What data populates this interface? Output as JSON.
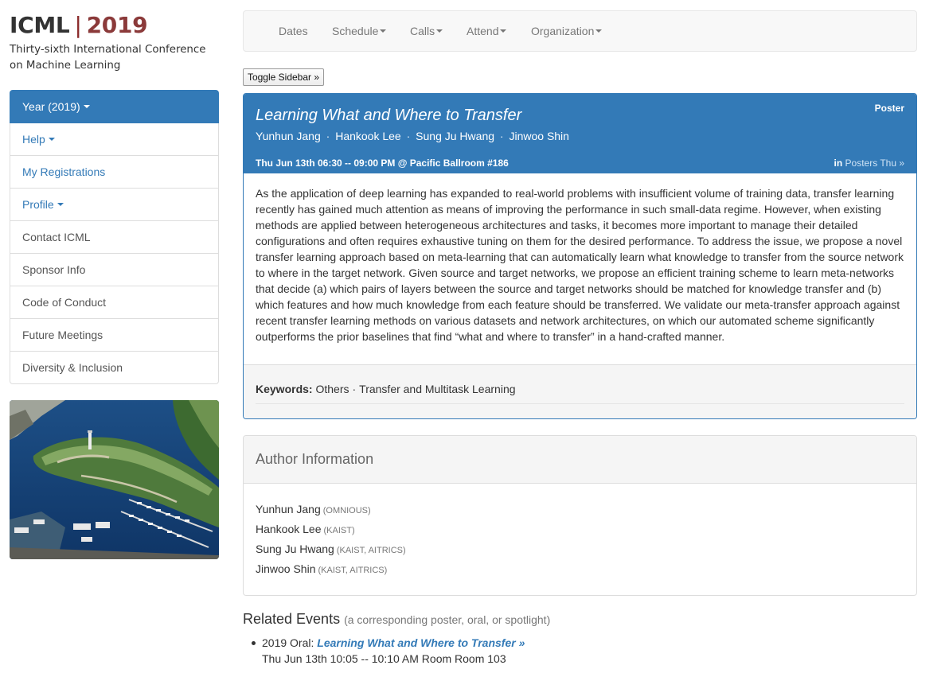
{
  "logo": {
    "name": "ICML",
    "separator": "|",
    "year": "2019",
    "subtitle": "Thirty-sixth International Conference on Machine Learning"
  },
  "sidebar": {
    "items": [
      {
        "label": "Year (2019)",
        "caret": true
      },
      {
        "label": "Help",
        "caret": true
      },
      {
        "label": "My Registrations",
        "caret": false
      },
      {
        "label": "Profile",
        "caret": true
      },
      {
        "label": "Contact ICML",
        "caret": false
      },
      {
        "label": "Sponsor Info",
        "caret": false
      },
      {
        "label": "Code of Conduct",
        "caret": false
      },
      {
        "label": "Future Meetings",
        "caret": false
      },
      {
        "label": "Diversity & Inclusion",
        "caret": false
      }
    ]
  },
  "navbar": {
    "items": [
      {
        "label": "Dates",
        "caret": false
      },
      {
        "label": "Schedule",
        "caret": true
      },
      {
        "label": "Calls",
        "caret": true
      },
      {
        "label": "Attend",
        "caret": true
      },
      {
        "label": "Organization",
        "caret": true
      }
    ]
  },
  "toggle_sidebar": {
    "label": "Toggle Sidebar »"
  },
  "event": {
    "type": "Poster",
    "title": "Learning What and Where to Transfer",
    "authors": [
      "Yunhun Jang",
      "Hankook Lee",
      "Sung Ju Hwang",
      "Jinwoo Shin"
    ],
    "author_separator": "·",
    "time_location": "Thu Jun 13th 06:30 -- 09:00 PM @ Pacific Ballroom #186",
    "in_label": "in",
    "in_link": "Posters Thu »",
    "abstract": "As the application of deep learning has expanded to real-world problems with insufficient volume of training data, transfer learning recently has gained much attention as means of improving the performance in such small-data regime. However, when existing methods are applied between heterogeneous architectures and tasks, it becomes more important to manage their detailed configurations and often requires exhaustive tuning on them for the desired performance. To address the issue, we propose a novel transfer learning approach based on meta-learning that can automatically learn what knowledge to transfer from the source network to where in the target network. Given source and target networks, we propose an efficient training scheme to learn meta-networks that decide (a) which pairs of layers between the source and target networks should be matched for knowledge transfer and (b) which features and how much knowledge from each feature should be transferred. We validate our meta-transfer approach against recent transfer learning methods on various datasets and network architectures, on which our automated scheme significantly outperforms the prior baselines that find “what and where to transfer” in a hand-crafted manner.",
    "keywords_label": "Keywords:",
    "keywords": [
      "Others",
      "Transfer and Multitask Learning"
    ]
  },
  "author_info": {
    "heading": "Author Information",
    "authors": [
      {
        "name": "Yunhun Jang",
        "affiliation": "(OMNIOUS)"
      },
      {
        "name": "Hankook Lee",
        "affiliation": "(KAIST)"
      },
      {
        "name": "Sung Ju Hwang",
        "affiliation": "(KAIST, AITRICS)"
      },
      {
        "name": "Jinwoo Shin",
        "affiliation": "(KAIST, AITRICS)"
      }
    ]
  },
  "related": {
    "heading": "Related Events",
    "note": "(a corresponding poster, oral, or spotlight)",
    "items": [
      {
        "prefix": "2019 Oral:",
        "link": "Learning What and Where to Transfer »",
        "detail": "Thu Jun 13th 10:05 -- 10:10 AM Room Room 103"
      }
    ]
  },
  "colors": {
    "primary": "#337ab7",
    "year_red": "#8b3a3a",
    "panel_gray": "#f5f5f5"
  },
  "icons": [
    "caret-down-icon"
  ]
}
